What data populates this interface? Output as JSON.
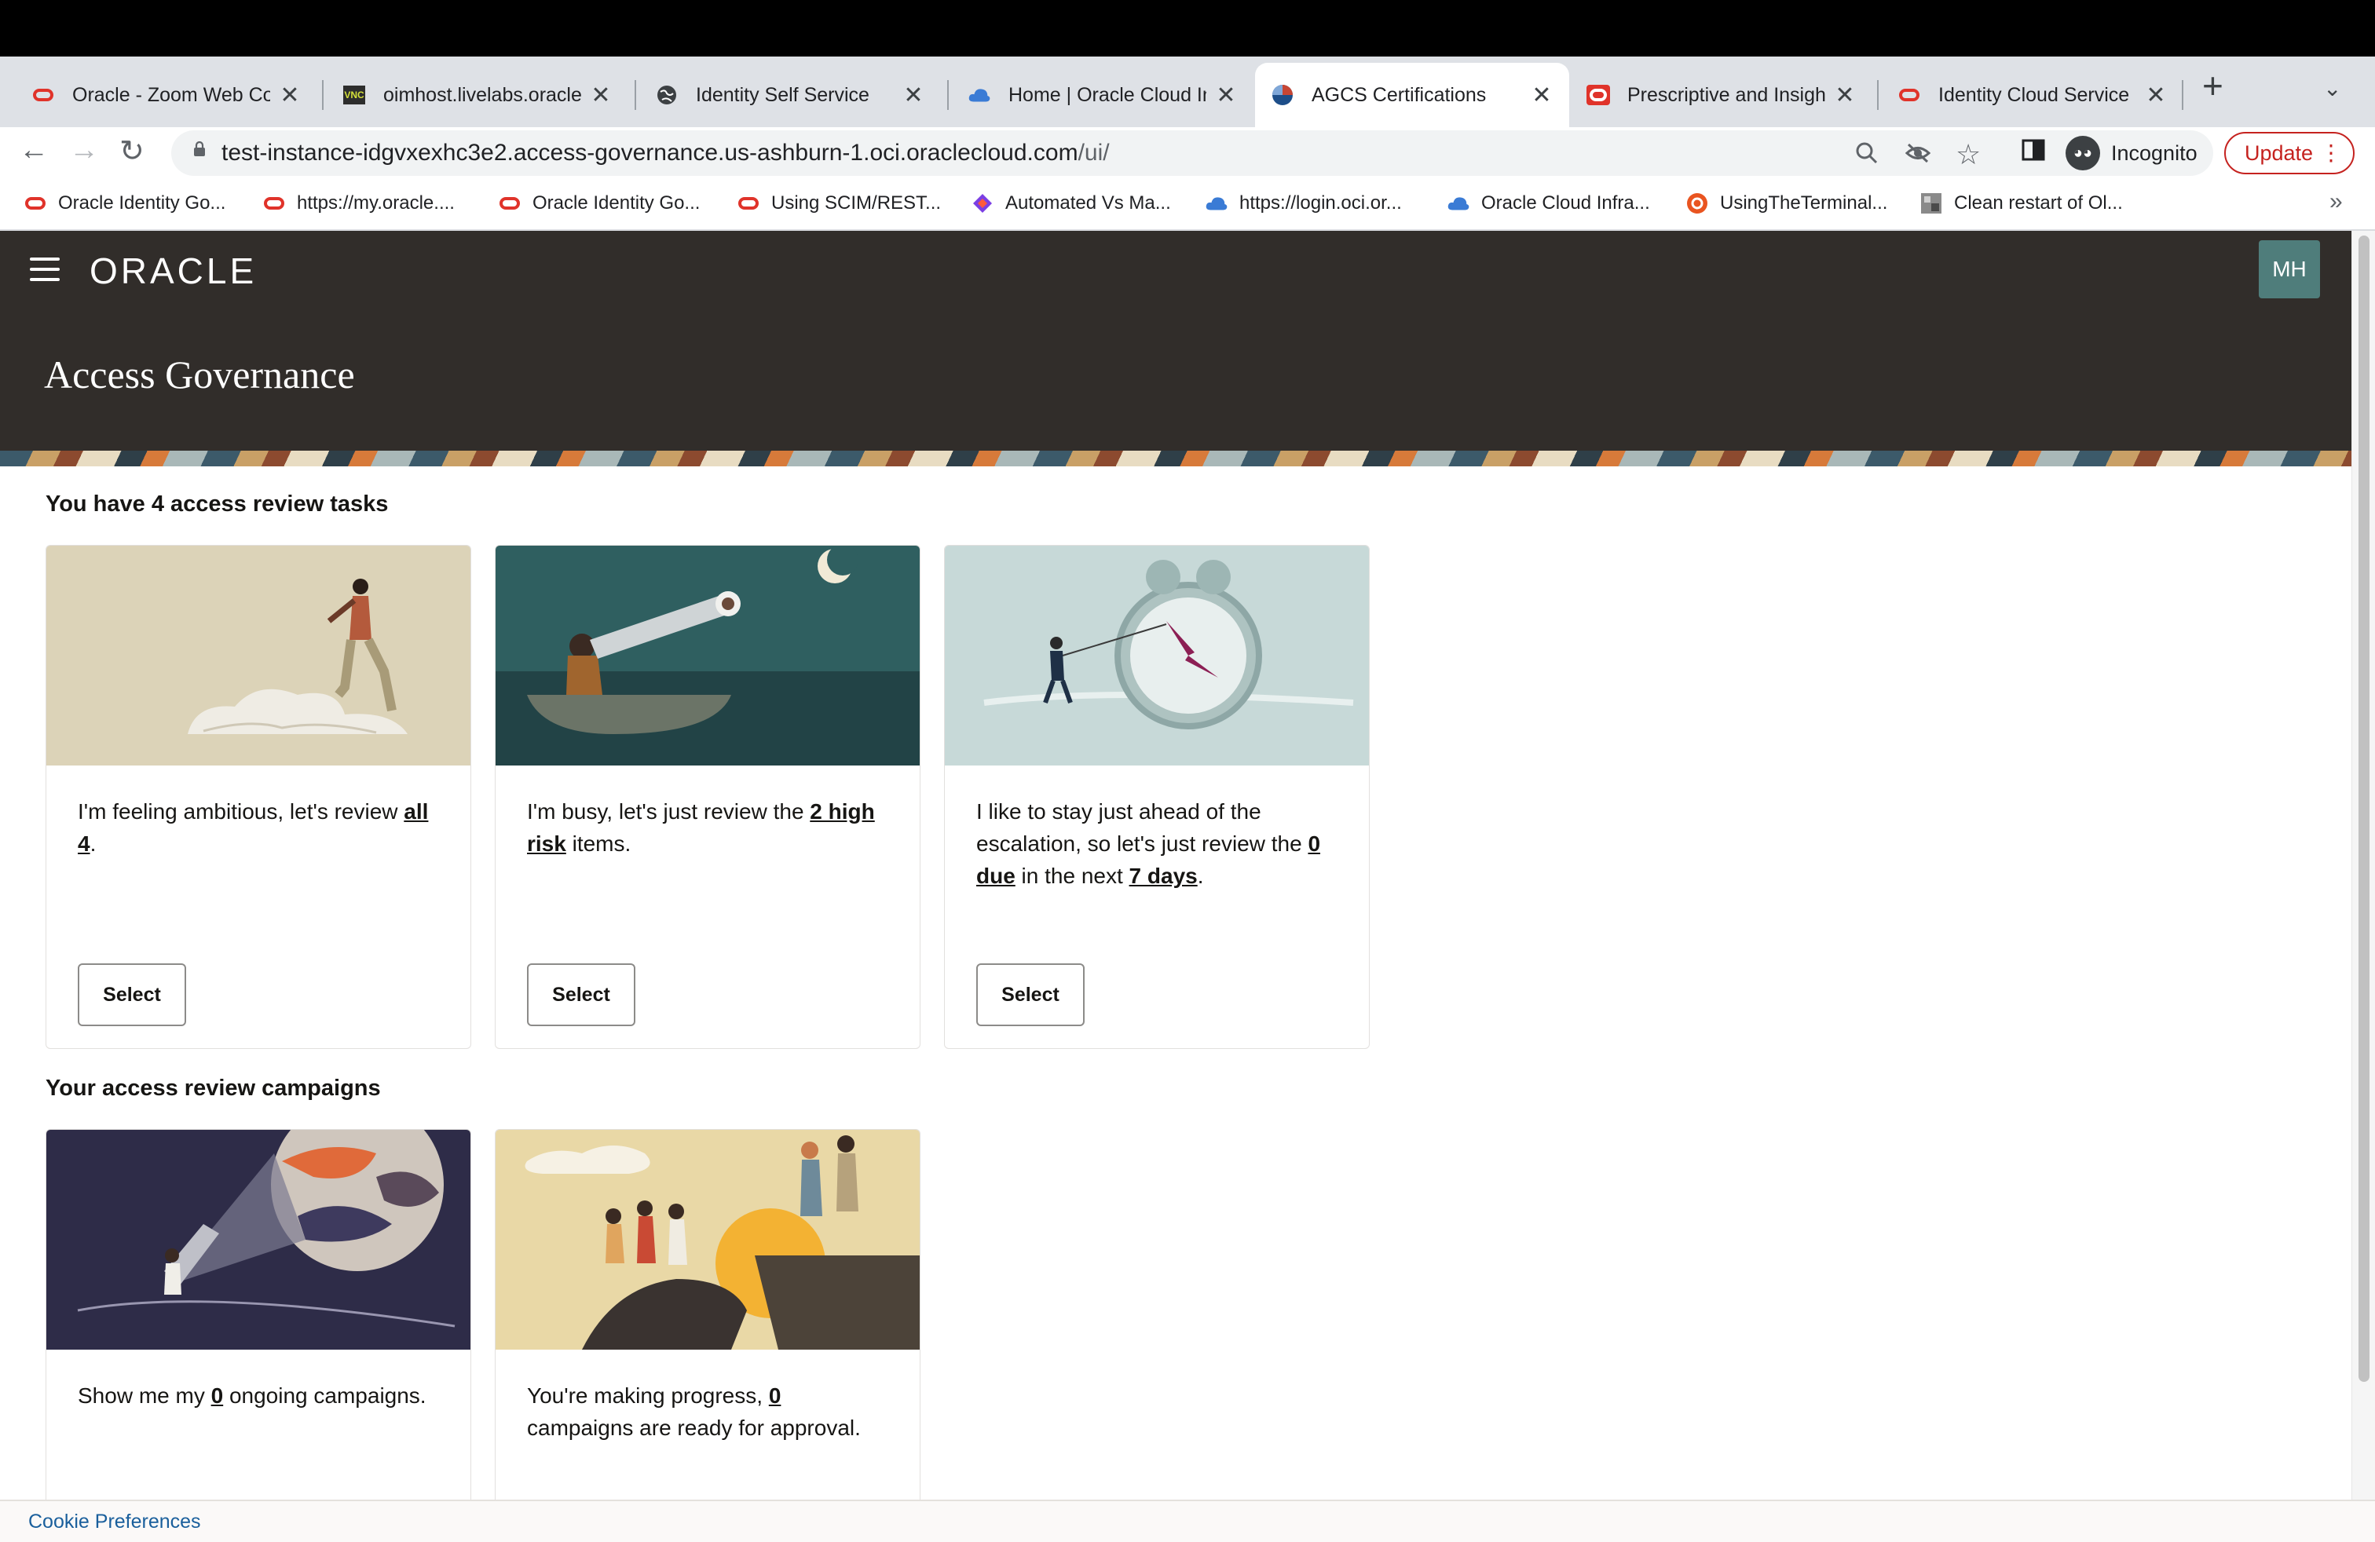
{
  "browser": {
    "tabs": [
      {
        "title": "Oracle - Zoom Web Cor",
        "icon": "oracle-icon"
      },
      {
        "title": "oimhost.livelabs.oraclev",
        "icon": "vnc-icon"
      },
      {
        "title": "Identity Self Service",
        "icon": "globe-icon"
      },
      {
        "title": "Home | Oracle Cloud Ini",
        "icon": "cloud-icon"
      },
      {
        "title": "AGCS Certifications",
        "icon": "agcs-icon"
      },
      {
        "title": "Prescriptive and Insight",
        "icon": "oracle-icon"
      },
      {
        "title": "Identity Cloud Service",
        "icon": "oracle-icon"
      }
    ],
    "url_main": "test-instance-idgvxexhc3e2.access-governance.us-ashburn-1.oci.oraclecloud.com",
    "url_path": "/ui/",
    "incognito_label": "Incognito",
    "update_label": "Update",
    "bookmarks": [
      {
        "label": "Oracle Identity Go...",
        "icon": "oracle-icon"
      },
      {
        "label": "https://my.oracle....",
        "icon": "oracle-icon"
      },
      {
        "label": "Oracle Identity Go...",
        "icon": "oracle-icon"
      },
      {
        "label": "Using SCIM/REST...",
        "icon": "oracle-icon"
      },
      {
        "label": "Automated Vs Ma...",
        "icon": "app-icon"
      },
      {
        "label": "https://login.oci.or...",
        "icon": "cloud-icon"
      },
      {
        "label": "Oracle Cloud Infra...",
        "icon": "cloud-icon"
      },
      {
        "label": "UsingTheTerminal...",
        "icon": "ubuntu-icon"
      },
      {
        "label": "Clean restart of Ol...",
        "icon": "image-icon"
      }
    ],
    "bookmarks_more": "»"
  },
  "header": {
    "logo": "ORACLE",
    "avatar": "MH",
    "title": "Access Governance"
  },
  "tasks": {
    "heading": "You have 4 access review tasks",
    "cards": [
      {
        "t1": "I'm feeling ambitious, let's review ",
        "b1": "all 4",
        "t2": "."
      },
      {
        "t1": "I'm busy, let's just review the ",
        "b1": "2 high risk",
        "t2": " items."
      },
      {
        "t1": "I like to stay just ahead of the escalation, so let's just review the ",
        "b1": "0 due",
        "t2": " in the next ",
        "b2": "7 days",
        "t3": "."
      }
    ],
    "select_label": "Select"
  },
  "campaigns": {
    "heading": "Your access review campaigns",
    "cards": [
      {
        "t1": "Show me my ",
        "b1": "0",
        "t2": " ongoing campaigns."
      },
      {
        "t1": "You're making progress, ",
        "b1": "0",
        "t2": " campaigns are ready for approval."
      }
    ]
  },
  "footer": {
    "cookie_label": "Cookie Preferences"
  }
}
